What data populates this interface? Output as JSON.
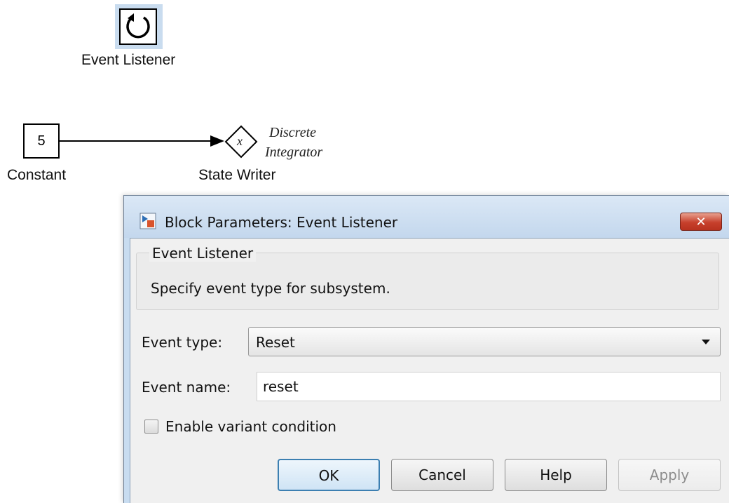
{
  "diagram": {
    "event_listener": {
      "label": "Event Listener",
      "icon": "reset-loop-icon"
    },
    "constant": {
      "value": "5",
      "label": "Constant"
    },
    "state_writer": {
      "symbol": "x",
      "label": "State Writer",
      "target_line1": "Discrete",
      "target_line2": "Integrator"
    }
  },
  "dialog": {
    "title": "Block Parameters: Event Listener",
    "close_symbol": "✕",
    "group": {
      "legend": "Event Listener",
      "description": "Specify event type for subsystem."
    },
    "event_type": {
      "label": "Event type:",
      "value": "Reset"
    },
    "event_name": {
      "label": "Event name:",
      "value": "reset"
    },
    "variant": {
      "label": "Enable variant condition",
      "checked": false
    },
    "buttons": {
      "ok": "OK",
      "cancel": "Cancel",
      "help": "Help",
      "apply": "Apply"
    }
  },
  "colors": {
    "dialog_frame": "#c8dcf0",
    "close_red": "#c7402c",
    "default_button_border": "#3c7fb1",
    "selection_highlight": "#c9dcef"
  }
}
